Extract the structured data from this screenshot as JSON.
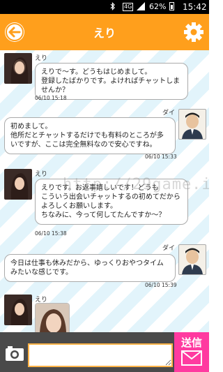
{
  "status_bar": {
    "network": "4G",
    "battery": "62%",
    "time": "15:42"
  },
  "header": {
    "title": "えり"
  },
  "messages": [
    {
      "sender": "えり",
      "side": "left",
      "text": "えりで～す。どうもはじめまして。\n登録したばかりです。よければチャットしませんか？",
      "time": "06/10 15:18"
    },
    {
      "sender": "ダイ",
      "side": "right",
      "text": "初めまして。\n他所だとチャットするだけでも有料のところが多いですが、ここは完全無料なので安心ですね。",
      "time": "06/10 15:33"
    },
    {
      "sender": "えり",
      "side": "left",
      "text": "えりです。お返事嬉しいです！どうも\nこういう出会いチャットするの初めてだからよろしくお願いします。\nちなみに、今って何してたんですか～？",
      "time": "06/10 15:38"
    },
    {
      "sender": "ダイ",
      "side": "right",
      "text": "今日は仕事も休みだから、ゆっくりおやつタイムみたいな感じです。",
      "time": "06/10 15:39"
    },
    {
      "sender": "えり",
      "side": "left"
    }
  ],
  "watermark": "http://29game.info/",
  "composer": {
    "value": "",
    "send_label": "送信"
  },
  "colors": {
    "accent": "#ff9f1c",
    "send": "#ff3aa0",
    "input_border": "#ffb347"
  }
}
